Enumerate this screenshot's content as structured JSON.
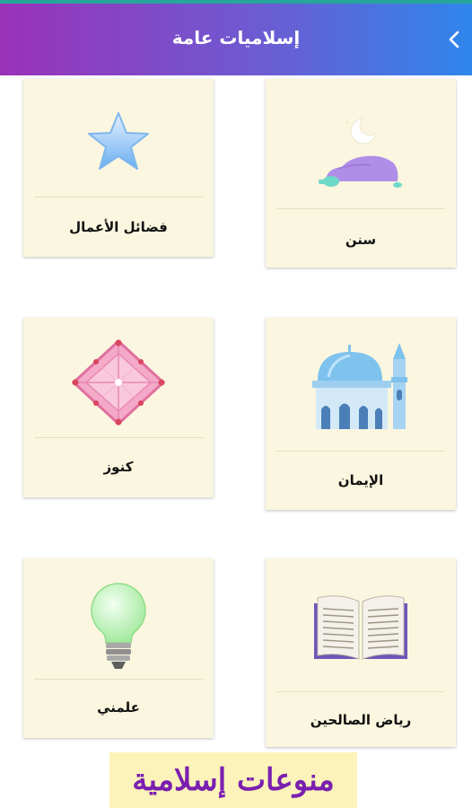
{
  "header": {
    "title": "إسلاميات عامة",
    "back_icon": "chevron-left-icon"
  },
  "colors": {
    "accent_top": "#26a69a",
    "header_gradient_start": "#9a32b8",
    "header_gradient_end": "#2f86ec",
    "card_background": "#fbf6df",
    "footer_text": "#7a1fb0",
    "footer_background": "#fbf3b9"
  },
  "cards": [
    {
      "label": "سنن",
      "icon": "prayer-sujood-icon"
    },
    {
      "label": "فضائل الأعمال",
      "icon": "star-icon"
    },
    {
      "label": "الإيمان",
      "icon": "mosque-icon"
    },
    {
      "label": "كنوز",
      "icon": "diamond-gem-icon"
    },
    {
      "label": "رياض الصالحين",
      "icon": "open-book-icon"
    },
    {
      "label": "علمني",
      "icon": "lightbulb-icon"
    }
  ],
  "footer": {
    "text": "منوعات إسلامية"
  }
}
